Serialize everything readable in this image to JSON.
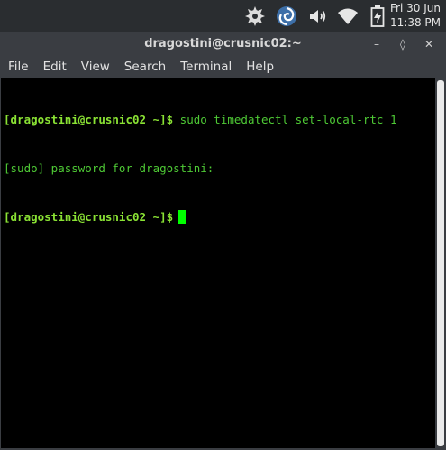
{
  "panel": {
    "clock_line1": "Fri 30 Jun",
    "clock_line2": "11:38 PM"
  },
  "window": {
    "title": "dragostini@crusnic02:~",
    "minimize_glyph": "–",
    "maximize_glyph": "◊",
    "close_glyph": "✕"
  },
  "menu": {
    "items": [
      "File",
      "Edit",
      "View",
      "Search",
      "Terminal",
      "Help"
    ]
  },
  "terminal": {
    "line1_prompt": "[dragostini@crusnic02 ~]$",
    "line1_cmd": " sudo timedatectl set-local-rtc 1",
    "line2": "[sudo] password for dragostini:",
    "line3_prompt": "[dragostini@crusnic02 ~]$"
  },
  "colors": {
    "prompt": "#8ae234",
    "output": "#4ec935",
    "cursor": "#00ff00",
    "background": "#000000"
  }
}
